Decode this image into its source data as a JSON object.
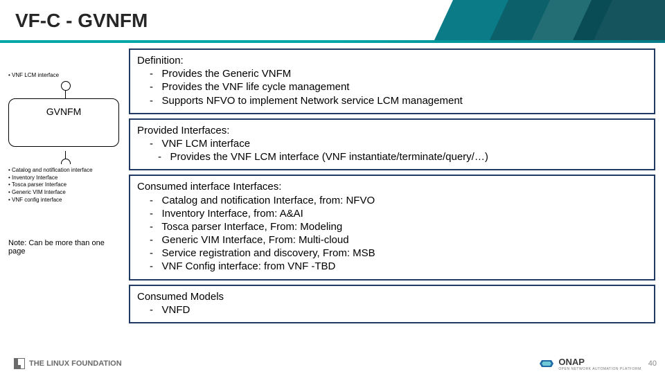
{
  "title": "VF-C - GVNFM",
  "left": {
    "top_bullets": [
      "VNF LCM interface"
    ],
    "box_label": "GVNFM",
    "bottom_bullets": [
      "Catalog and notification interface",
      "Inventory Interface",
      "Tosca  parser Interface",
      "Generic VIM Interface",
      "VNF config interface"
    ],
    "note": "Note: Can be more than one page"
  },
  "sections": [
    {
      "heading": "Definition:",
      "items": [
        "Provides the Generic  VNFM",
        "Provides the VNF life cycle management",
        "Supports NFVO to implement Network service LCM management"
      ]
    },
    {
      "heading": "Provided Interfaces:",
      "items": [
        "VNF LCM interface"
      ],
      "subitems_of_0": [
        "Provides the VNF LCM interface (VNF instantiate/terminate/query/…)"
      ]
    },
    {
      "heading": "Consumed interface Interfaces:",
      "items": [
        "Catalog and notification Interface, from: NFVO",
        "Inventory Interface, from: A&AI",
        "Tosca parser Interface, From: Modeling",
        "Generic VIM Interface, From: Multi-cloud",
        "Service registration and discovery, From: MSB",
        "VNF Config interface: from VNF -TBD"
      ]
    },
    {
      "heading": "Consumed Models",
      "items": [
        "VNFD"
      ]
    }
  ],
  "footer": {
    "linux_foundation_prefix": "THE",
    "linux_foundation_main": "LINUX",
    "linux_foundation_suffix": "FOUNDATION",
    "onap": "ONAP",
    "onap_sub": "OPEN NETWORK AUTOMATION PLATFORM",
    "page_number": "40"
  }
}
